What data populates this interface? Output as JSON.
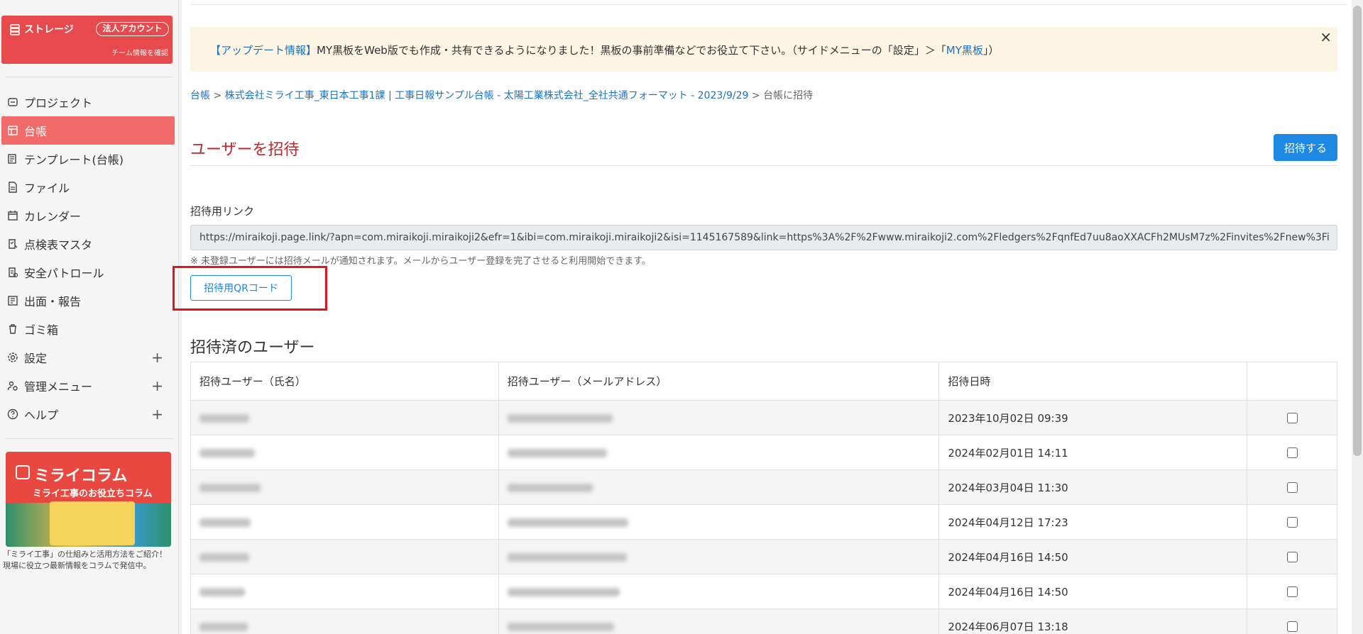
{
  "sidebar": {
    "storage_label": "ストレージ",
    "corp_badge": "法人アカウント",
    "team_link": "チーム情報を確認",
    "items": [
      {
        "label": "プロジェクト",
        "icon": "project-icon",
        "expandable": false
      },
      {
        "label": "台帳",
        "icon": "ledger-icon",
        "active": true,
        "expandable": false
      },
      {
        "label": "テンプレート(台帳)",
        "icon": "template-icon",
        "expandable": false
      },
      {
        "label": "ファイル",
        "icon": "file-icon",
        "expandable": false
      },
      {
        "label": "カレンダー",
        "icon": "calendar-icon",
        "expandable": false
      },
      {
        "label": "点検表マスタ",
        "icon": "checklist-icon",
        "expandable": false
      },
      {
        "label": "安全パトロール",
        "icon": "patrol-icon",
        "expandable": false
      },
      {
        "label": "出面・報告",
        "icon": "report-icon",
        "expandable": false
      },
      {
        "label": "ゴミ箱",
        "icon": "trash-icon",
        "expandable": false
      },
      {
        "label": "設定",
        "icon": "gear-icon",
        "expandable": true
      },
      {
        "label": "管理メニュー",
        "icon": "admin-icon",
        "expandable": true
      },
      {
        "label": "ヘルプ",
        "icon": "help-icon",
        "expandable": true
      }
    ],
    "column_card": {
      "title": "ミライコラム",
      "subtitle": "ミライ工事のお役立ちコラム",
      "description": "「ミライ工事」の仕組みと活用方法をご紹介！現場に役立つ最新情報をコラムで発信中。"
    }
  },
  "alert": {
    "tag": "【アップデート情報】",
    "text": "MY黒板をWeb版でも作成・共有できるようになりました！黒板の事前準備などでお役立て下さい。（サイドメニューの「設定」＞「",
    "link": "MY黒板",
    "tail": "」）",
    "close": "×"
  },
  "breadcrumb": {
    "root": "台帳",
    "ledger": "株式会社ミライ工事_東日本工事1課 | 工事日報サンプル台帳 - 太陽工業株式会社_全社共通フォーマット - 2023/9/29",
    "current": "台帳に招待",
    "separator": ">"
  },
  "page": {
    "title": "ユーザーを招待",
    "invite_button": "招待する",
    "link_label": "招待用リンク",
    "invite_link": "https://miraikoji.page.link/?apn=com.miraikoji.miraikoji2&efr=1&ibi=com.miraikoji.miraikoji2&isi=1145167589&link=https%3A%2F%2Fwww.miraikoji2.com%2Fledgers%2FqnfEd7uu8aoXXACFh2MUsM7z%2Finvites%2Fnew%3Fi",
    "note": "※ 未登録ユーザーには招待メールが通知されます。メールからユーザー登録を完了させると利用開始できます。",
    "qr_button": "招待用QRコード",
    "section_title": "招待済のユーザー"
  },
  "table": {
    "headers": [
      "招待ユーザー（氏名）",
      "招待ユーザー（メールアドレス）",
      "招待日時",
      ""
    ],
    "rows": [
      {
        "date": "2023年10月02日 09:39"
      },
      {
        "date": "2024年02月01日 14:11"
      },
      {
        "date": "2024年03月04日 11:30"
      },
      {
        "date": "2024年04月12日 17:23"
      },
      {
        "date": "2024年04月16日 14:50"
      },
      {
        "date": "2024年04月16日 14:50"
      },
      {
        "date": "2024年06月07日 13:18"
      }
    ]
  },
  "colors": {
    "brand_red": "#e74a4d",
    "active_nav": "#f26b6b",
    "primary_blue": "#1e88e5",
    "title_red": "#c0262b",
    "alert_bg": "#fdf4e3",
    "highlight": "#e0141b"
  }
}
